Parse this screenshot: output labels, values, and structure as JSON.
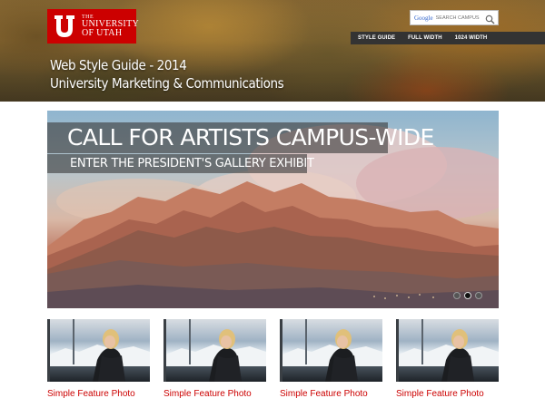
{
  "logo": {
    "line1": "THE",
    "line2": "UNIVERSITY",
    "line3": "OF UTAH",
    "icon": "u-block-logo-icon",
    "brand_color": "#cc0000"
  },
  "search": {
    "brand_prefix": "Google",
    "placeholder": "SEARCH CAMPUS",
    "icon": "search-icon"
  },
  "topnav": {
    "items": [
      {
        "label": "STYLE GUIDE"
      },
      {
        "label": "FULL WIDTH"
      },
      {
        "label": "1024 WIDTH"
      }
    ]
  },
  "site": {
    "title_line1": "Web Style Guide - 2014",
    "title_line2": "University Marketing & Communications"
  },
  "hero": {
    "headline": "CALL FOR ARTISTS CAMPUS-WIDE",
    "subheadline": "ENTER THE PRESIDENT'S GALLERY EXHIBIT",
    "active_slide": 2,
    "slide_count": 3
  },
  "features": [
    {
      "label": "Simple Feature Photo"
    },
    {
      "label": "Simple Feature Photo"
    },
    {
      "label": "Simple Feature Photo"
    },
    {
      "label": "Simple Feature Photo"
    }
  ]
}
